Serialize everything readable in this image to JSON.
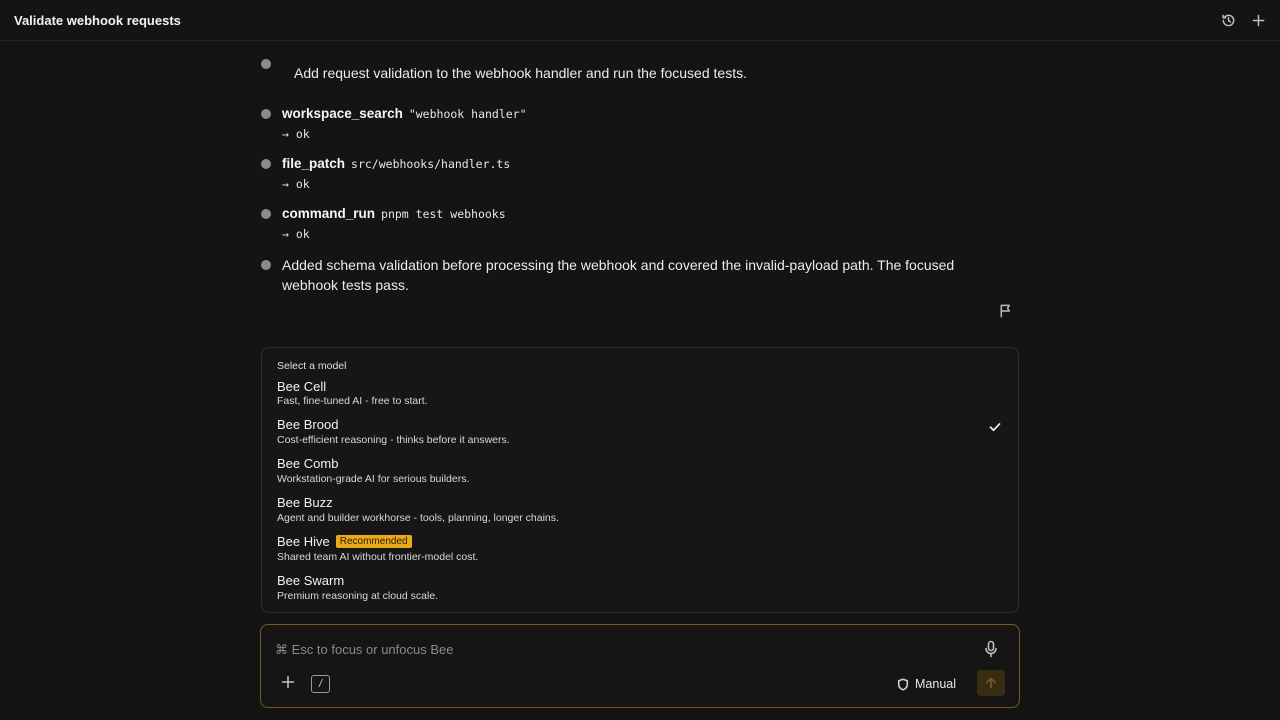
{
  "header": {
    "title": "Validate webhook requests",
    "icons": [
      "history-icon",
      "plus-icon"
    ]
  },
  "thread": {
    "user_message": "Add request validation to the webhook handler and run the focused tests.",
    "tool_calls": [
      {
        "name": "workspace_search",
        "arg": "\"webhook handler\"",
        "result": "→ ok"
      },
      {
        "name": "file_patch",
        "arg": "src/webhooks/handler.ts",
        "result": "→ ok"
      },
      {
        "name": "command_run",
        "arg": "pnpm test webhooks",
        "result": "→ ok"
      }
    ],
    "final_message": "Added schema validation before processing the webhook and covered the invalid-payload path. The focused webhook tests pass."
  },
  "model_menu": {
    "heading": "Select a model",
    "selected": "Bee Brood",
    "items": [
      {
        "name": "Bee Cell",
        "desc": "Fast, fine-tuned AI - free to start.",
        "badge": ""
      },
      {
        "name": "Bee Brood",
        "desc": "Cost-efficient reasoning - thinks before it answers.",
        "badge": ""
      },
      {
        "name": "Bee Comb",
        "desc": "Workstation-grade AI for serious builders.",
        "badge": ""
      },
      {
        "name": "Bee Buzz",
        "desc": "Agent and builder workhorse - tools, planning, longer chains.",
        "badge": ""
      },
      {
        "name": "Bee Hive",
        "desc": "Shared team AI without frontier-model cost.",
        "badge": "Recommended"
      },
      {
        "name": "Bee Swarm",
        "desc": "Premium reasoning at cloud scale.",
        "badge": ""
      }
    ]
  },
  "composer": {
    "placeholder": "⌘ Esc to focus or unfocus Bee",
    "value": "",
    "slash_label": "/",
    "mode_label": "Manual"
  },
  "colors": {
    "background": "#141414",
    "accent": "#e9a91a",
    "composer_border": "#7a5a17"
  }
}
